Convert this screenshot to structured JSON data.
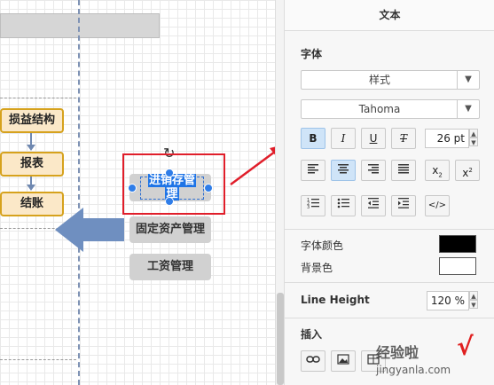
{
  "canvas": {
    "flow_boxes": [
      "损益结构",
      "报表",
      "结账"
    ],
    "gray_boxes": [
      "固定资产管理",
      "工资管理"
    ],
    "selected_box": {
      "line1": "进销存管",
      "line2": "理"
    }
  },
  "panel": {
    "title": "文本",
    "font_section": "字体",
    "style_select": "样式",
    "font_select": "Tahoma",
    "format": {
      "bold": "B",
      "italic": "I",
      "underline": "U",
      "clear": "T"
    },
    "font_size": "26 pt",
    "align": [
      "left",
      "center",
      "right",
      "justify"
    ],
    "subscript": "x",
    "superscript": "x",
    "list_buttons": [
      "numbered-list",
      "bulleted-list",
      "outdent",
      "indent"
    ],
    "html_button": "</>",
    "font_color_label": "字体颜色",
    "bg_color_label": "背景色",
    "font_color": "#000000",
    "bg_color": "#ffffff",
    "line_height_label": "Line Height",
    "line_height_value": "120 %",
    "insert_label": "插入",
    "insert_buttons": [
      "link",
      "image",
      "table"
    ]
  },
  "watermark": {
    "text": "经验啦",
    "url": "jingyanla.com",
    "check": "√"
  },
  "colors": {
    "accent": "#1e74e6",
    "highlight_red": "#e01e2a",
    "flow_fill": "#fbe8c8",
    "flow_border": "#d6a21d"
  }
}
